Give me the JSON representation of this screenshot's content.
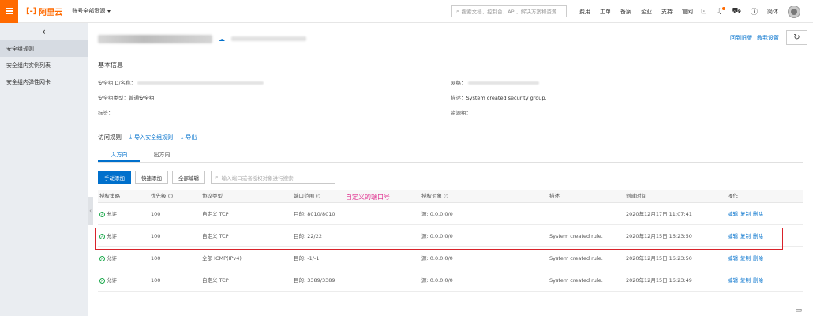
{
  "topbar": {
    "logo_mark": "[-]",
    "logo_text": "阿里云",
    "account_label": "账号全部资源",
    "search_placeholder": "搜索文档、控制台、API、解决方案和资源",
    "nav": [
      "费用",
      "工单",
      "备案",
      "企业",
      "支持",
      "官网"
    ],
    "lang": "简体"
  },
  "sidebar": {
    "back_glyph": "‹",
    "items": [
      {
        "label": "安全组规则",
        "active": true
      },
      {
        "label": "安全组内实例列表",
        "active": false
      },
      {
        "label": "安全组内弹性网卡",
        "active": false
      }
    ]
  },
  "header": {
    "return_link": "回到旧版",
    "tutorial_link": "教我设置"
  },
  "basic_info": {
    "title": "基本信息",
    "id_name_label": "安全组ID/名称：",
    "network_label": "网络：",
    "type_label": "安全组类型：",
    "type_value": "普通安全组",
    "desc_label": "描述：",
    "desc_value": "System created security group.",
    "tags_label": "标签：",
    "resource_group_label": "资源组："
  },
  "rules": {
    "title": "访问规则",
    "import_label": "导入安全组规则",
    "export_label": "导出",
    "tabs": [
      {
        "label": "入方向",
        "active": true
      },
      {
        "label": "出方向",
        "active": false
      }
    ],
    "buttons": {
      "manual_add": "手动添加",
      "quick_add": "快速添加",
      "edit_all": "全部编辑"
    },
    "search_placeholder": "输入端口或者授权对象进行搜索",
    "annotation": "自定义的端口号",
    "columns": {
      "policy": "授权策略",
      "priority": "优先级",
      "protocol": "协议类型",
      "port": "端口范围",
      "source": "授权对象",
      "desc": "描述",
      "created": "创建时间",
      "ops": "操作"
    },
    "rows": [
      {
        "policy": "允许",
        "priority": "100",
        "protocol": "自定义 TCP",
        "port": "目的: 8010/8010",
        "source": "源: 0.0.0.0/0",
        "desc": "",
        "created": "2020年12月17日 11:07:41",
        "ops": [
          "编辑",
          "复制",
          "删除"
        ]
      },
      {
        "policy": "允许",
        "priority": "100",
        "protocol": "自定义 TCP",
        "port": "目的: 22/22",
        "source": "源: 0.0.0.0/0",
        "desc": "System created rule.",
        "created": "2020年12月15日 16:23:50",
        "ops": [
          "编辑",
          "复制",
          "删除"
        ]
      },
      {
        "policy": "允许",
        "priority": "100",
        "protocol": "全部 ICMP(IPv4)",
        "port": "目的: -1/-1",
        "source": "源: 0.0.0.0/0",
        "desc": "System created rule.",
        "created": "2020年12月15日 16:23:50",
        "ops": [
          "编辑",
          "复制",
          "删除"
        ]
      },
      {
        "policy": "允许",
        "priority": "100",
        "protocol": "自定义 TCP",
        "port": "目的: 3389/3389",
        "source": "源: 0.0.0.0/0",
        "desc": "System created rule.",
        "created": "2020年12月15日 16:23:49",
        "ops": [
          "编辑",
          "复制",
          "删除"
        ]
      }
    ]
  },
  "colors": {
    "brand": "#ff6a00",
    "link": "#0070cc",
    "highlight": "#d9222a",
    "annotation": "#e0308f",
    "ok": "#1aa84a"
  }
}
